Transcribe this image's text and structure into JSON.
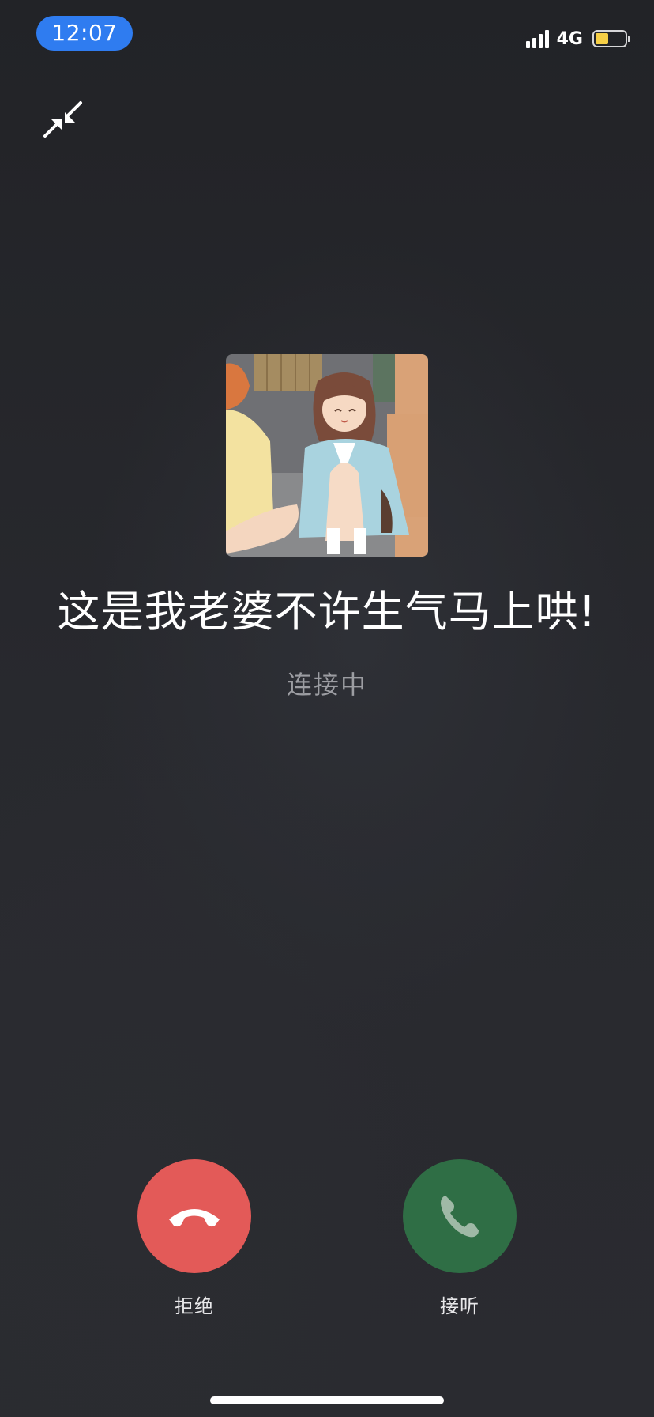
{
  "status_bar": {
    "time": "12:07",
    "network": "4G",
    "time_pill_color": "#2f7cf0",
    "battery_fill_color": "#f6cf46",
    "signal_icon": "cellular-signal-icon",
    "battery_icon": "battery-low-icon"
  },
  "controls": {
    "minimize_icon": "minimize-arrows-icon"
  },
  "caller": {
    "avatar_icon": "cartoon-couple-avatar",
    "name": "这是我老婆不许生气马上哄!",
    "status": "连接中"
  },
  "actions": {
    "decline": {
      "label": "拒绝",
      "icon": "hang-up-phone-icon",
      "color": "#e35a58"
    },
    "accept": {
      "label": "接听",
      "icon": "phone-answer-icon",
      "color": "#2f6e45"
    }
  }
}
